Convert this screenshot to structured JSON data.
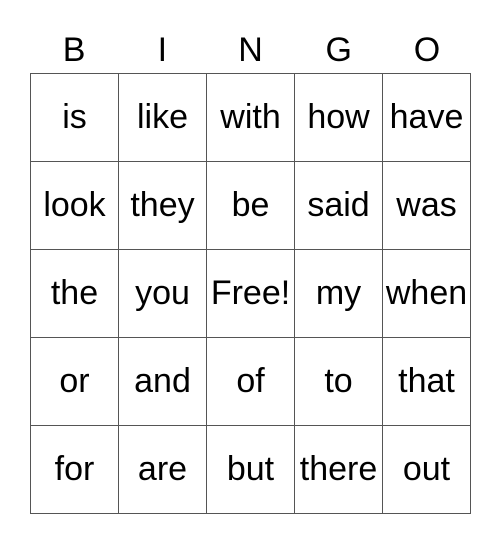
{
  "header": [
    "B",
    "I",
    "N",
    "G",
    "O"
  ],
  "rows": [
    [
      "is",
      "like",
      "with",
      "how",
      "have"
    ],
    [
      "look",
      "they",
      "be",
      "said",
      "was"
    ],
    [
      "the",
      "you",
      "Free!",
      "my",
      "when"
    ],
    [
      "or",
      "and",
      "of",
      "to",
      "that"
    ],
    [
      "for",
      "are",
      "but",
      "there",
      "out"
    ]
  ]
}
